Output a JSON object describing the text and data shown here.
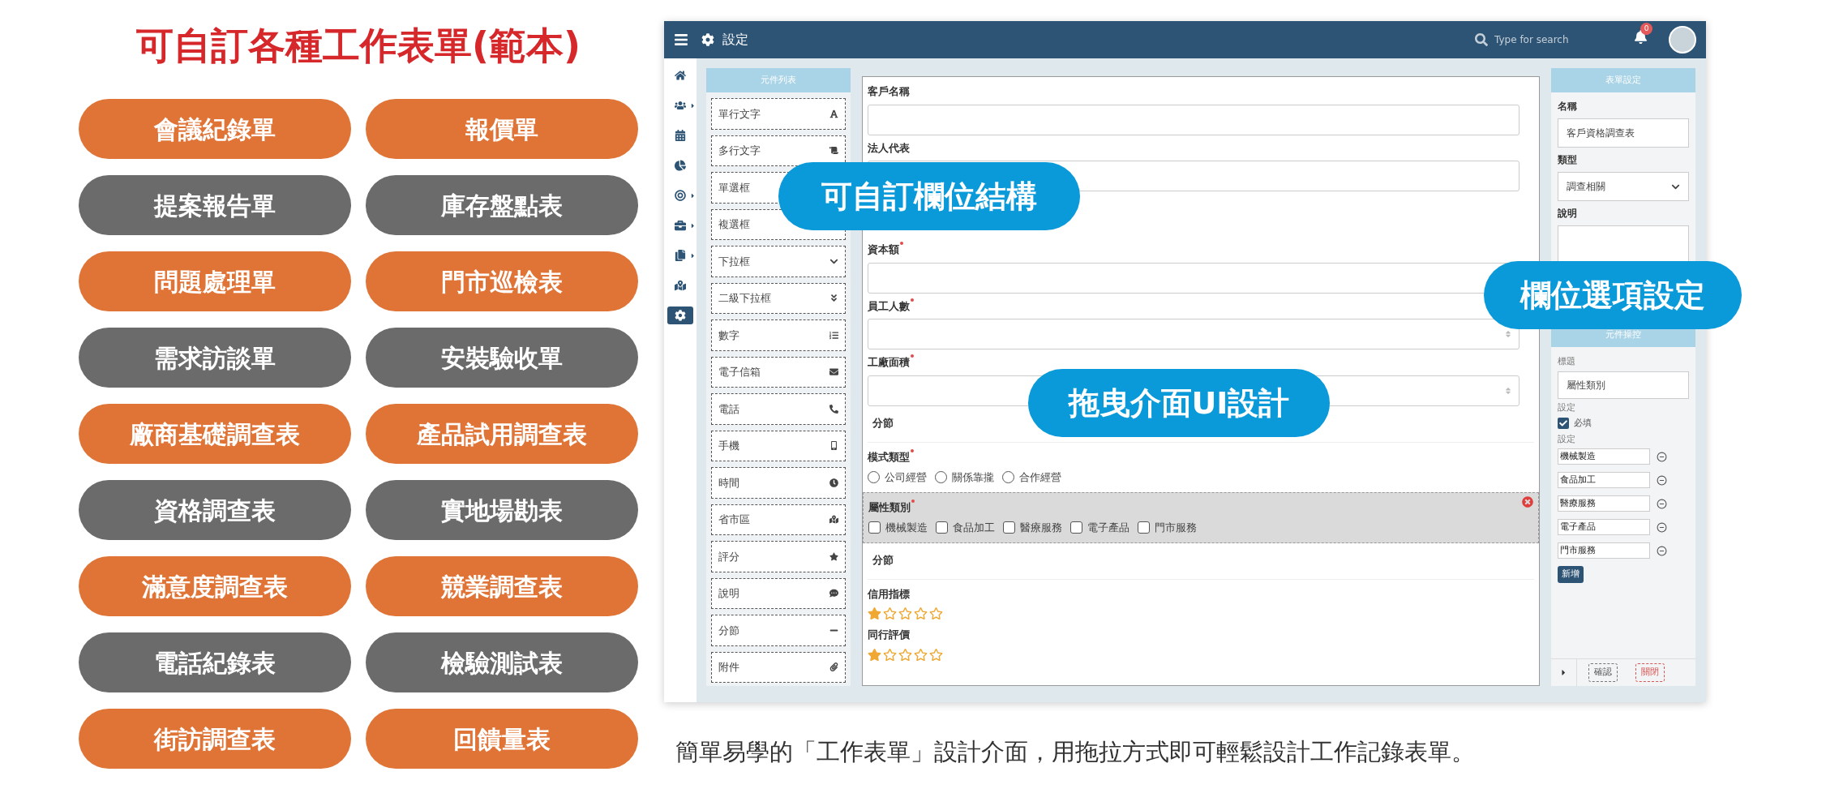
{
  "title": "可自訂各種工作表單(範本)",
  "templates": [
    {
      "label": "會議紀錄單",
      "color": "#e07436"
    },
    {
      "label": "報價單",
      "color": "#e07436"
    },
    {
      "label": "提案報告單",
      "color": "#6b6b6b"
    },
    {
      "label": "庫存盤點表",
      "color": "#6b6b6b"
    },
    {
      "label": "問題處理單",
      "color": "#e07436"
    },
    {
      "label": "門市巡檢表",
      "color": "#e07436"
    },
    {
      "label": "需求訪談單",
      "color": "#6b6b6b"
    },
    {
      "label": "安裝驗收單",
      "color": "#6b6b6b"
    },
    {
      "label": "廠商基礎調查表",
      "color": "#e07436"
    },
    {
      "label": "產品試用調查表",
      "color": "#e07436"
    },
    {
      "label": "資格調查表",
      "color": "#6b6b6b"
    },
    {
      "label": "實地場勘表",
      "color": "#6b6b6b"
    },
    {
      "label": "滿意度調查表",
      "color": "#e07436"
    },
    {
      "label": "競業調查表",
      "color": "#e07436"
    },
    {
      "label": "電話紀錄表",
      "color": "#6b6b6b"
    },
    {
      "label": "檢驗測試表",
      "color": "#6b6b6b"
    },
    {
      "label": "街訪調查表",
      "color": "#e07436"
    },
    {
      "label": "回饋量表",
      "color": "#e07436"
    }
  ],
  "app": {
    "header": {
      "title": "設定",
      "search": {
        "placeholder": "Type for search"
      },
      "notification_count": "0"
    },
    "nav": [
      {
        "kind": "home",
        "submenu": false,
        "selected": false
      },
      {
        "kind": "users",
        "submenu": true,
        "selected": false
      },
      {
        "kind": "calendar",
        "submenu": false,
        "selected": false
      },
      {
        "kind": "chart",
        "submenu": false,
        "selected": false
      },
      {
        "kind": "target",
        "submenu": true,
        "selected": false
      },
      {
        "kind": "briefcase",
        "submenu": true,
        "selected": false
      },
      {
        "kind": "copy",
        "submenu": true,
        "selected": false
      },
      {
        "kind": "map",
        "submenu": false,
        "selected": false
      },
      {
        "kind": "settings",
        "submenu": false,
        "selected": true
      }
    ],
    "components_panel": {
      "title": "元件列表",
      "items": [
        {
          "label": "單行文字",
          "kind": "text"
        },
        {
          "label": "多行文字",
          "kind": "textarea"
        },
        {
          "label": "單選框",
          "kind": "radio"
        },
        {
          "label": "複選框",
          "kind": "checkbox"
        },
        {
          "label": "下拉框",
          "kind": "select"
        },
        {
          "label": "二級下拉框",
          "kind": "cascade"
        },
        {
          "label": "數字",
          "kind": "number"
        },
        {
          "label": "電子信箱",
          "kind": "email"
        },
        {
          "label": "電話",
          "kind": "phone"
        },
        {
          "label": "手機",
          "kind": "mobile"
        },
        {
          "label": "時間",
          "kind": "time"
        },
        {
          "label": "省市區",
          "kind": "region"
        },
        {
          "label": "評分",
          "kind": "rating"
        },
        {
          "label": "說明",
          "kind": "note"
        },
        {
          "label": "分節",
          "kind": "section"
        },
        {
          "label": "附件",
          "kind": "attachment"
        }
      ]
    },
    "form": {
      "fields": [
        {
          "kind": "input",
          "label": "客戶名稱",
          "required": false
        },
        {
          "kind": "input",
          "label": "法人代表",
          "required": false
        },
        {
          "kind": "gap"
        },
        {
          "kind": "input",
          "label": "資本額",
          "required": true
        },
        {
          "kind": "number",
          "label": "員工人數",
          "required": true
        },
        {
          "kind": "number",
          "label": "工廠面積",
          "required": true
        },
        {
          "kind": "section",
          "label": "分節"
        },
        {
          "kind": "radio",
          "label": "模式類型",
          "required": true,
          "selected": false,
          "options": [
            {
              "label": "公司經營",
              "checked": false
            },
            {
              "label": "關係靠攏",
              "checked": false
            },
            {
              "label": "合作經營",
              "checked": false
            }
          ]
        },
        {
          "kind": "checkbox",
          "label": "屬性類別",
          "required": true,
          "selected": true,
          "options": [
            {
              "label": "機械製造",
              "checked": false
            },
            {
              "label": "食品加工",
              "checked": false
            },
            {
              "label": "醫療服務",
              "checked": false
            },
            {
              "label": "電子產品",
              "checked": false
            },
            {
              "label": "門市服務",
              "checked": false
            }
          ]
        },
        {
          "kind": "section",
          "label": "分節"
        },
        {
          "kind": "rating",
          "label": "信用指標",
          "stars": 1
        },
        {
          "kind": "rating",
          "label": "同行評價",
          "stars": 1
        }
      ]
    },
    "settings_panel": {
      "title": "表單設定",
      "name_label": "名稱",
      "name_value": "客戶資格調查表",
      "type_label": "類型",
      "type_value": "調查相關",
      "description_label": "說明",
      "control_title": "元件操控",
      "caption_label": "標題",
      "caption_value": "屬性類別",
      "setting_label": "設定",
      "required": {
        "label": "必填",
        "checked": true
      },
      "options_label": "設定",
      "options": [
        "機械製造",
        "食品加工",
        "醫療服務",
        "電子產品",
        "門市服務"
      ],
      "add_button": "新增",
      "confirm_button": "確認",
      "close_button": "關閉"
    }
  },
  "callouts": [
    "可自訂欄位結構",
    "欄位選項設定",
    "拖曳介面UI設計"
  ],
  "caption": "簡單易學的「工作表單」設計介面，用拖拉方式即可輕鬆設計工作記錄表單。"
}
